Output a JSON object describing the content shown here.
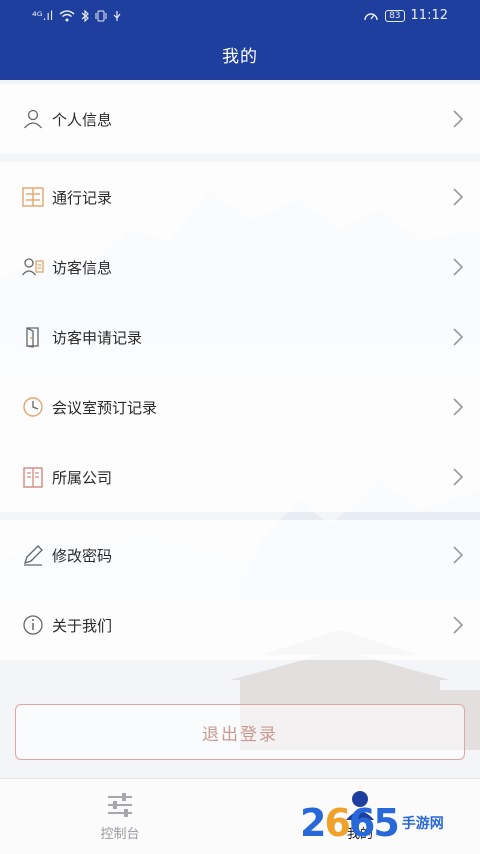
{
  "status_bar": {
    "network": "⁴ᴳ.ıl",
    "battery": "83",
    "time": "11:12"
  },
  "header": {
    "title": "我的"
  },
  "groups": [
    {
      "items": [
        {
          "label": "个人信息",
          "icon": "person-icon"
        }
      ]
    },
    {
      "items": [
        {
          "label": "通行记录",
          "icon": "gate-icon"
        },
        {
          "label": "访客信息",
          "icon": "visitor-icon"
        },
        {
          "label": "访客申请记录",
          "icon": "door-icon"
        },
        {
          "label": "会议室预订记录",
          "icon": "clock-icon"
        },
        {
          "label": "所属公司",
          "icon": "building-icon"
        }
      ]
    },
    {
      "items": [
        {
          "label": "修改密码",
          "icon": "pencil-icon"
        },
        {
          "label": "关于我们",
          "icon": "info-icon"
        }
      ]
    }
  ],
  "logout": {
    "label": "退出登录"
  },
  "tabbar": {
    "tabs": [
      {
        "label": "控制台",
        "icon": "sliders-icon",
        "active": false
      },
      {
        "label": "我的",
        "icon": "user-icon",
        "active": true
      }
    ]
  },
  "watermark": {
    "number_a": "2",
    "number_b": "6",
    "number_c": "65",
    "text": "手游网"
  },
  "colors": {
    "header_bg": "#1f3f9e",
    "logout_text": "#c99a92",
    "logout_border": "#d9a9a2",
    "active_tab_icon": "#1f3f9e",
    "icon_accent": "#e3a66c"
  }
}
